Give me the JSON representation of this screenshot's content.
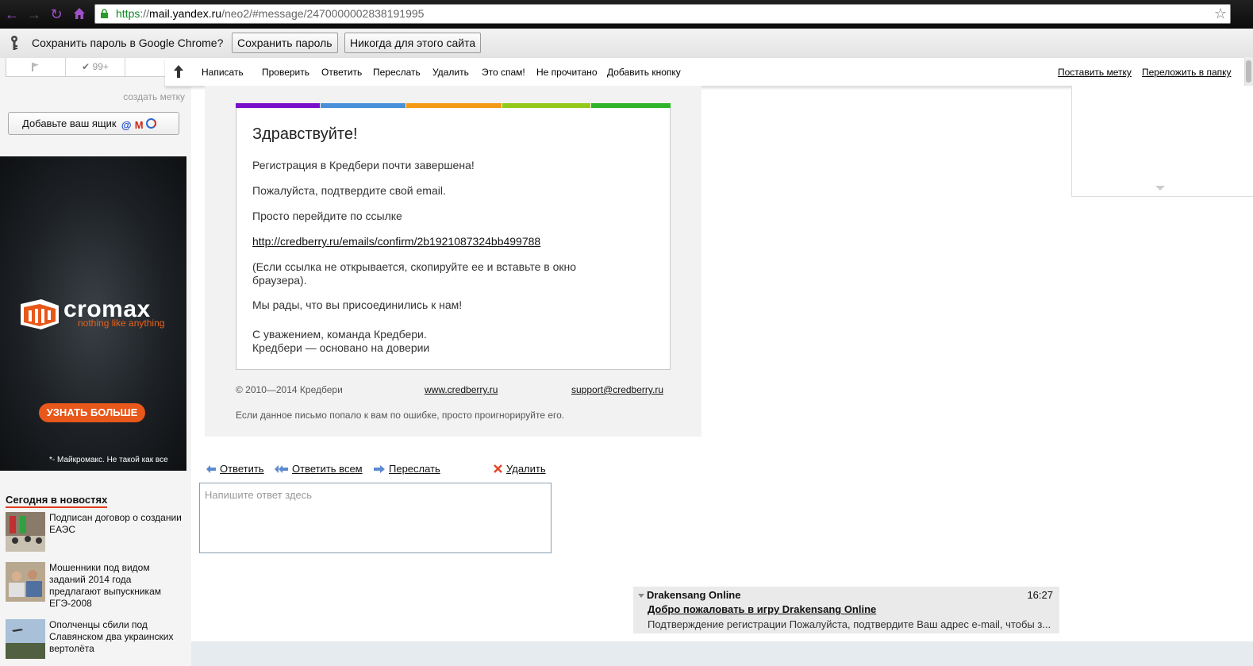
{
  "browser": {
    "url_secure": "https",
    "url_sep": "://",
    "url_host": "mail.yandex.ru",
    "url_path": "/neo2/#message/2470000002838191995"
  },
  "password_bar": {
    "prompt": "Сохранить пароль в Google Chrome?",
    "save_label": "Сохранить пароль",
    "never_label": "Никогда для этого сайта"
  },
  "sidebar": {
    "tools_count": "99+",
    "create_label": "создать метку",
    "add_mailbox": "Добавьте ваш ящик",
    "ad": {
      "brand": "cromax",
      "tagline": "nothing like anything",
      "cta": "УЗНАТЬ БОЛЬШЕ",
      "disclaimer": "*- Майкромакс. Не такой как все"
    },
    "news_title": "Сегодня в новостях",
    "news": [
      {
        "text": "Подписан договор о создании ЕАЭС"
      },
      {
        "text": "Мошенники под видом заданий 2014 года предлагают выпускникам ЕГЭ-2008"
      },
      {
        "text": "Ополченцы сбили под Славянском два украинских вертолёта"
      }
    ]
  },
  "toolbar": {
    "items": [
      "Написать",
      "Проверить",
      "Ответить",
      "Переслать",
      "Удалить",
      "Это спам!",
      "Не прочитано",
      "Добавить кнопку"
    ],
    "right": [
      "Поставить метку",
      "Переложить в папку"
    ]
  },
  "letter": {
    "stripe_colors": [
      "#7b10c9",
      "#4a90d9",
      "#f59a16",
      "#94c91a",
      "#2fb52a"
    ],
    "greeting": "Здравствуйте!",
    "p1": "Регистрация в Кредбери почти завершена!",
    "p2": "Пожалуйста, подтвердите свой email.",
    "p3": "Просто перейдите по ссылке",
    "link": "http://credberry.ru/emails/confirm/2b1921087324bb499788",
    "p4": "(Если ссылка не открывается, скопируйте ее и вставьте в окно браузера).",
    "p5": "Мы рады, что вы присоединились к нам!",
    "sign1": "С уважением, команда Кредбери.",
    "sign2": "Кредбери — основано на доверии",
    "copyright": "© 2010—2014 Кредбери",
    "site": "www.credberry.ru",
    "support": "support@credberry.ru",
    "disclaimer": "Если данное письмо попало к вам по ошибке, просто проигнорируйте его."
  },
  "reply": {
    "reply_label": "Ответить",
    "reply_all_label": "Ответить всем",
    "forward_label": "Переслать",
    "delete_label": "Удалить",
    "placeholder": "Напишите ответ здесь"
  },
  "next_message": {
    "sender": "Drakensang Online",
    "time": "16:27",
    "subject": "Добро пожаловать в игру Drakensang Online",
    "preview": "Подтверждение регистрации Пожалуйста, подтвердите Ваш адрес e-mail, чтобы з..."
  }
}
